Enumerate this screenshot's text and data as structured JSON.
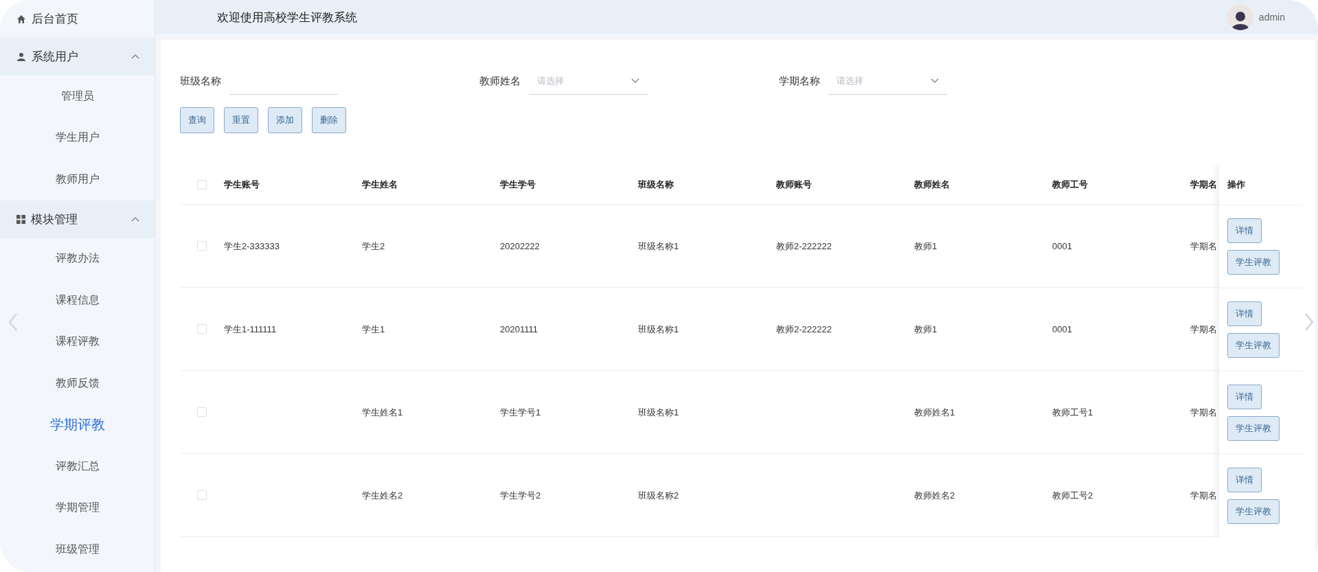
{
  "header": {
    "title": "欢迎使用高校学生评教系统",
    "user": "admin"
  },
  "sidebar": {
    "items": [
      {
        "kind": "link",
        "label": "后台首页"
      },
      {
        "kind": "group",
        "label": "系统用户",
        "expanded": true,
        "children": [
          {
            "label": "管理员",
            "selected": false
          },
          {
            "label": "学生用户",
            "selected": false
          },
          {
            "label": "教师用户",
            "selected": false
          }
        ]
      },
      {
        "kind": "group",
        "label": "模块管理",
        "expanded": true,
        "children": [
          {
            "label": "评教办法",
            "selected": false
          },
          {
            "label": "课程信息",
            "selected": false
          },
          {
            "label": "课程评教",
            "selected": false
          },
          {
            "label": "教师反馈",
            "selected": false
          },
          {
            "label": "学期评教",
            "selected": true
          },
          {
            "label": "评教汇总",
            "selected": false
          },
          {
            "label": "学期管理",
            "selected": false
          },
          {
            "label": "班级管理",
            "selected": false
          }
        ]
      }
    ]
  },
  "filters": [
    {
      "kind": "input",
      "label": "班级名称"
    },
    {
      "kind": "select",
      "label": "教师姓名",
      "placeholder": "请选择"
    },
    {
      "kind": "select",
      "label": "学期名称",
      "placeholder": "请选择"
    }
  ],
  "buttons": [
    "查询",
    "重置",
    "添加",
    "删除"
  ],
  "table": {
    "all_checked": false,
    "columns": [
      "学生账号",
      "学生姓名",
      "学生学号",
      "班级名称",
      "教师账号",
      "教师姓名",
      "教师工号",
      "学期名"
    ],
    "action_column": "操作",
    "rows": [
      {
        "checked": false,
        "cells": [
          "学生2-333333",
          "学生2",
          "20202222",
          "班级名称1",
          "教师2-222222",
          "教师1",
          "0001",
          "学期名"
        ],
        "actions": [
          "详情",
          "学生评教"
        ]
      },
      {
        "checked": false,
        "cells": [
          "学生1-111111",
          "学生1",
          "20201111",
          "班级名称1",
          "教师2-222222",
          "教师1",
          "0001",
          "学期名"
        ],
        "actions": [
          "详情",
          "学生评教"
        ]
      },
      {
        "checked": false,
        "cells": [
          null,
          "学生姓名1",
          "学生学号1",
          "班级名称1",
          null,
          "教师姓名1",
          "教师工号1",
          "学期名"
        ],
        "actions": [
          "详情",
          "学生评教"
        ]
      },
      {
        "checked": false,
        "cells": [
          null,
          "学生姓名2",
          "学生学号2",
          "班级名称2",
          null,
          "教师姓名2",
          "教师工号2",
          "学期名"
        ],
        "actions": [
          "详情",
          "学生评教"
        ]
      }
    ]
  }
}
